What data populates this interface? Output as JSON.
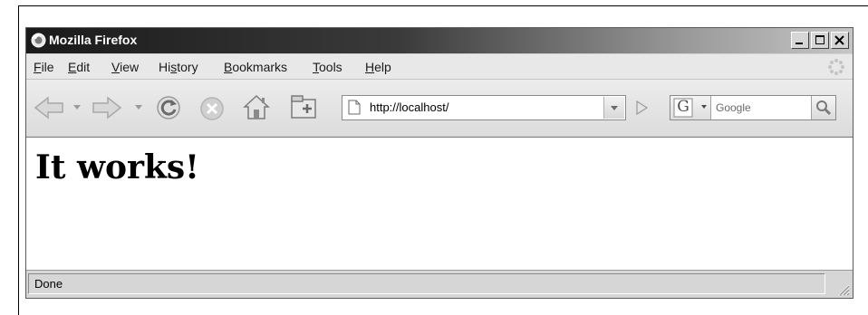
{
  "window": {
    "title": "Mozilla Firefox"
  },
  "menu": {
    "items": [
      {
        "label": "File",
        "accel": "F",
        "rest": "ile"
      },
      {
        "label": "Edit",
        "accel": "E",
        "rest": "dit"
      },
      {
        "label": "View",
        "accel": "V",
        "rest": "iew"
      },
      {
        "label": "History",
        "pre": "Hi",
        "accel": "s",
        "rest": "tory"
      },
      {
        "label": "Bookmarks",
        "accel": "B",
        "rest": "ookmarks"
      },
      {
        "label": "Tools",
        "accel": "T",
        "rest": "ools"
      },
      {
        "label": "Help",
        "accel": "H",
        "rest": "elp"
      }
    ]
  },
  "navigation": {
    "back": "back-arrow-icon",
    "forward": "forward-arrow-icon",
    "reload": "reload-icon",
    "stop": "stop-icon",
    "home": "home-icon",
    "new_tab": "new-tab-icon"
  },
  "address_bar": {
    "url": "http://localhost/"
  },
  "search": {
    "engine_letter": "G",
    "placeholder": "Google"
  },
  "content": {
    "heading": "It works!"
  },
  "status": {
    "text": "Done"
  }
}
